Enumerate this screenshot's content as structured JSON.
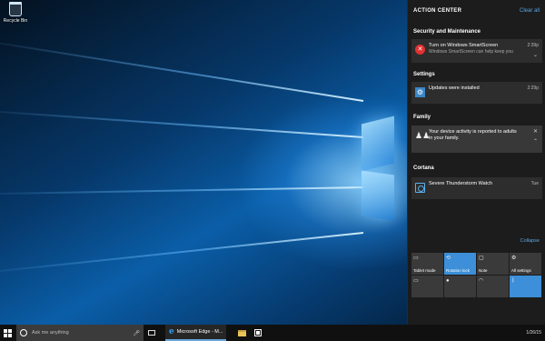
{
  "desktop": {
    "icons": [
      {
        "label": "Recycle Bin",
        "icon": "recycle-bin-icon"
      }
    ]
  },
  "action_center": {
    "title": "ACTION CENTER",
    "clear_all": "Clear all",
    "groups": [
      {
        "title": "Security and Maintenance",
        "notification": {
          "icon": "error-icon",
          "title": "Turn on Windows SmartScreen",
          "body": "Windows SmartScreen can help keep you",
          "time": "2:39p"
        }
      },
      {
        "title": "Settings",
        "notification": {
          "icon": "gear-icon",
          "title": "Updates were installed",
          "body": "",
          "time": "2:29p"
        }
      },
      {
        "title": "Family",
        "notification": {
          "icon": "family-icon",
          "title": "Your device activity is reported to adults in your family.",
          "body": "",
          "time": ""
        }
      },
      {
        "title": "Cortana",
        "notification": {
          "icon": "cortana-icon",
          "title": "Severe Thunderstorm Watch",
          "body": "",
          "time": "Tue"
        }
      }
    ],
    "collapse": "Collapse",
    "quick_actions": [
      {
        "label": "Tablet mode",
        "icon": "tablet-mode-icon",
        "active": false
      },
      {
        "label": "Rotation lock",
        "icon": "rotation-lock-icon",
        "active": true
      },
      {
        "label": "Note",
        "icon": "note-icon",
        "active": false
      },
      {
        "label": "All settings",
        "icon": "settings-icon",
        "active": false
      },
      {
        "label": "",
        "icon": "",
        "active": false
      },
      {
        "label": "",
        "icon": "",
        "active": false
      },
      {
        "label": "",
        "icon": "wifi-icon",
        "active": false
      },
      {
        "label": "",
        "icon": "bluetooth-icon",
        "active": true
      }
    ]
  },
  "taskbar": {
    "search_placeholder": "Ask me anything",
    "edge_label": "Microsoft Edge - M...",
    "clock_time": "",
    "clock_date": "1/26/15"
  },
  "colors": {
    "accent": "#3c8fd8",
    "error": "#e03131",
    "action_center_bg": "#1c1c1c",
    "notification_bg": "#2d2d2d"
  }
}
